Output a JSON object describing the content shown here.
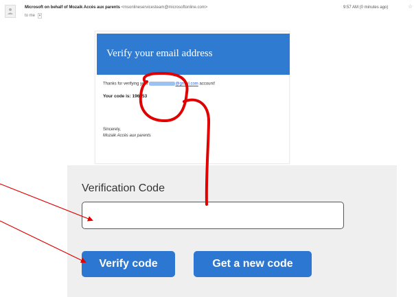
{
  "email": {
    "sender_name": "Microsoft on behalf of Mozaik Accès aux parents",
    "sender_email": "<msonlineservicesteam@microsoftonline.com>",
    "to": "to me",
    "time": "9:57 AM (0 minutes ago)",
    "title": "Verify your email address",
    "thanks_prefix": "Thanks for verifying your",
    "thanks_domain": "@gmail.com",
    "thanks_suffix": "account!",
    "code_line": "Your code is: 196553",
    "sincerely": "Sincerely,",
    "signature": "Mozaik Accès aux parents",
    "header_color": "#2f7bd1"
  },
  "verify": {
    "label": "Verification Code",
    "input_value": "",
    "input_placeholder": "",
    "verify_button": "Verify code",
    "new_code_button": "Get a new code",
    "button_color": "#2b77d2"
  },
  "annotations": {
    "color": "#e00000"
  }
}
